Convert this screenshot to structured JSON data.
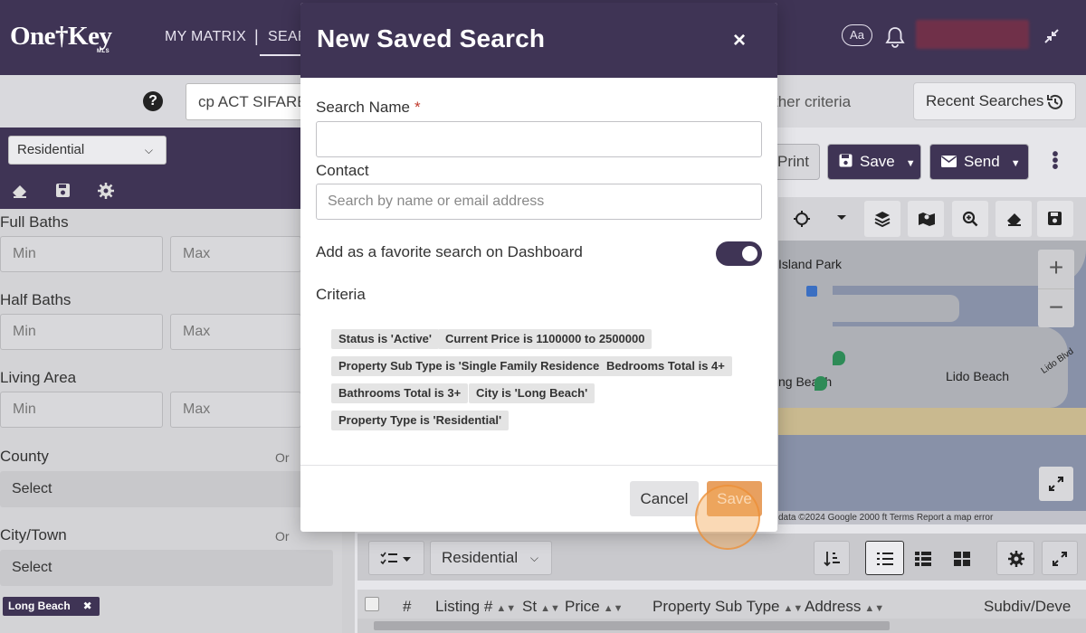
{
  "app": {
    "logo_text": "One†Key",
    "logo_sub": "MLS",
    "nav": [
      "MY MATRIX",
      "|",
      "SEAR"
    ],
    "aa_label": "Aa"
  },
  "search": {
    "query": "cp ACT SIFARE",
    "other_criteria": "ther criteria",
    "recent_searches": "Recent Searches"
  },
  "toolbar": {
    "print": "Print",
    "save": "Save",
    "send": "Send"
  },
  "left_panel": {
    "property_type": "Residential",
    "full_baths": "Full Baths",
    "half_baths": "Half Baths",
    "living_area": "Living Area",
    "county": "County",
    "city_town": "City/Town",
    "min": "Min",
    "max": "Max",
    "or": "Or",
    "select": "Select",
    "tag": "Long Beach"
  },
  "map": {
    "label_island_park": "Island Park",
    "label_lido_beach": "Lido Beach",
    "label_long_beach": "ng Beach",
    "label_lido_blvd": "Lido Blvd",
    "footer": "data ©2024 Google   2000 ft   Terms   Report a map error",
    "zoom_in": "+",
    "zoom_out": "−"
  },
  "results": {
    "type_select": "Residential",
    "columns": [
      "#",
      "Listing #",
      "St",
      "Price",
      "Property Sub Type",
      "Address",
      "Subdiv/Deve"
    ]
  },
  "modal": {
    "title": "New Saved Search",
    "close": "×",
    "search_name_label": "Search Name",
    "required_mark": "*",
    "search_name_value": "",
    "contact_label": "Contact",
    "contact_placeholder": "Search by name or email address",
    "favorite_label": "Add as a favorite search on Dashboard",
    "favorite_on": true,
    "criteria_label": "Criteria",
    "criteria": [
      "Status is 'Active'",
      "Current Price is 1100000 to 2500000",
      "Property Sub Type is 'Single Family Residence'",
      "Bedrooms Total is 4+",
      "Bathrooms Total is 3+",
      "City is 'Long Beach'",
      "Property Type is 'Residential'"
    ],
    "cancel": "Cancel",
    "save": "Save"
  },
  "colors": {
    "brand_purple": "#3f3455",
    "save_orange": "#e8a060"
  }
}
